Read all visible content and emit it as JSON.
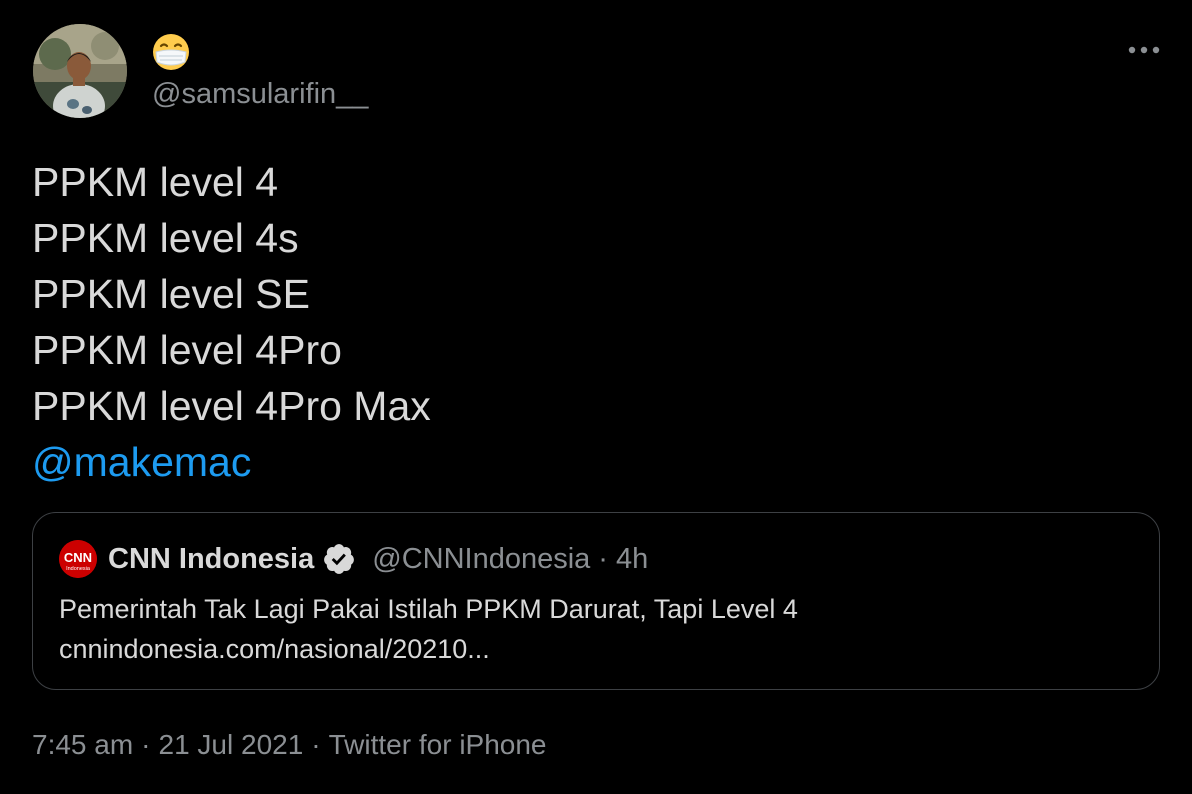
{
  "author": {
    "display_name_icon": "face-with-medical-mask-icon",
    "handle": "@samsularifin__",
    "avatar": "avatar"
  },
  "more_icon": "more-horizontal-icon",
  "tweet": {
    "lines": [
      "PPKM level 4",
      "PPKM level 4s",
      "PPKM level SE",
      "PPKM level 4Pro",
      "PPKM level 4Pro Max"
    ],
    "mention": "@makemac"
  },
  "quote": {
    "logo_text": "CNN",
    "logo_subtext": "Indonesia",
    "name": "CNN Indonesia",
    "verified_icon": "verified-badge-icon",
    "handle": "@CNNIndonesia",
    "separator": "·",
    "time": "4h",
    "title": "Pemerintah Tak Lagi Pakai Istilah PPKM Darurat, Tapi Level 4",
    "link": "cnnindonesia.com/nasional/20210..."
  },
  "meta": {
    "time": "7:45 am",
    "separator": "·",
    "date": "21 Jul 2021",
    "source": "Twitter for iPhone"
  },
  "colors": {
    "background": "#000000",
    "text": "#d9d9d9",
    "muted": "#8b8f93",
    "link": "#1d9bf0",
    "border": "#3d4044",
    "cnn_red": "#cc0000"
  }
}
